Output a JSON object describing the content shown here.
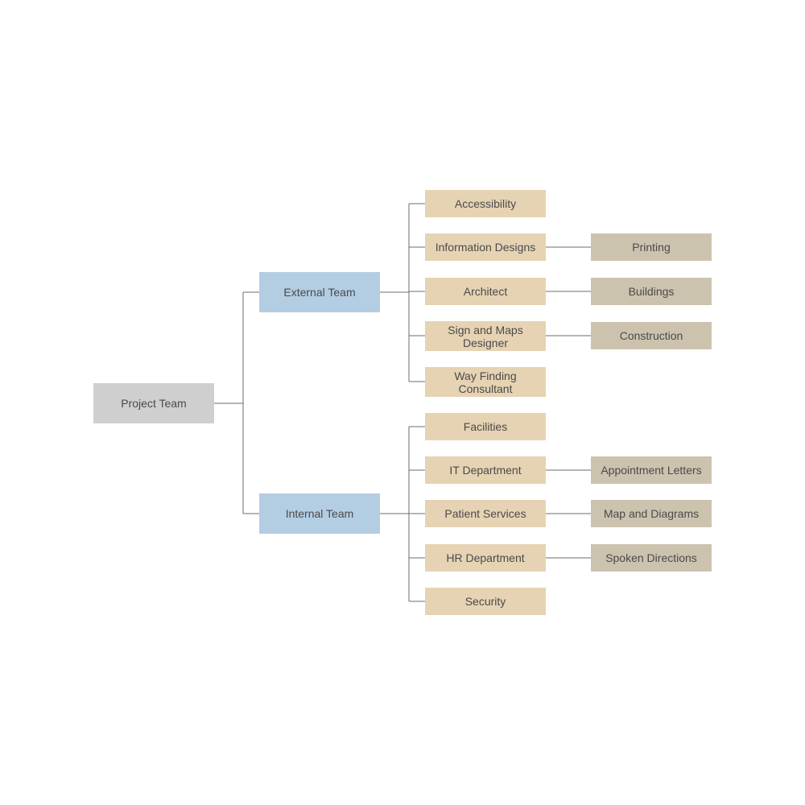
{
  "colors": {
    "root": "#cfcfcf",
    "team": "#b3cde3",
    "department": "#e6d3b3",
    "leaf": "#ccc3af",
    "connector": "#6e6e6e",
    "text": "#4a4a4a"
  },
  "root": {
    "label": "Project Team"
  },
  "teams": [
    {
      "label": "External Team",
      "departments": [
        {
          "label": "Accessibility",
          "child": null
        },
        {
          "label": "Information Designs",
          "child": "Printing"
        },
        {
          "label": "Architect",
          "child": "Buildings"
        },
        {
          "label": "Sign and Maps Designer",
          "child": "Construction"
        },
        {
          "label": "Way Finding Consultant",
          "child": null
        }
      ]
    },
    {
      "label": "Internal Team",
      "departments": [
        {
          "label": "Facilities",
          "child": null
        },
        {
          "label": "IT Department",
          "child": "Appointment Letters"
        },
        {
          "label": "Patient Services",
          "child": "Map and Diagrams"
        },
        {
          "label": "HR Department",
          "child": "Spoken Directions"
        },
        {
          "label": "Security",
          "child": null
        }
      ]
    }
  ]
}
